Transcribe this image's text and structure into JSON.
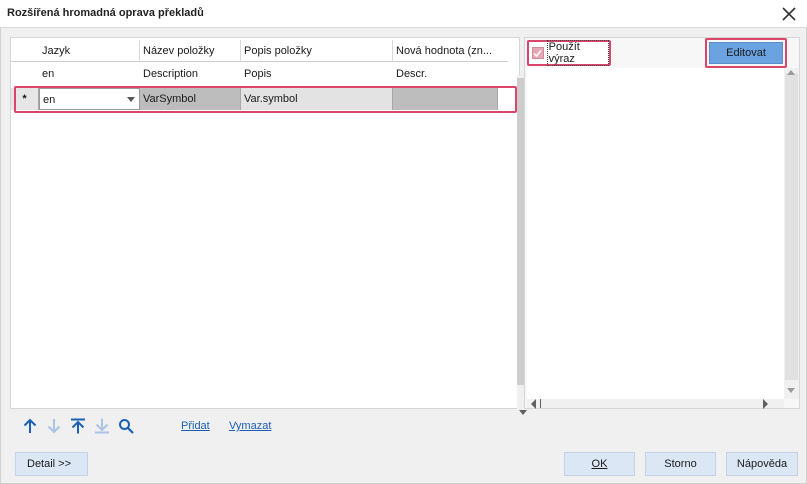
{
  "window": {
    "title": "Rozšířená hromadná oprava překladů"
  },
  "grid": {
    "columns": [
      "Jazyk",
      "Název položky",
      "Popis položky",
      "Nová hodnota (zn..."
    ],
    "rows": [
      {
        "indicator": "",
        "jazyk": "en",
        "nazev": "Description",
        "popis": "Popis",
        "nova": "Descr."
      },
      {
        "indicator": "*",
        "jazyk": "en",
        "nazev": "VarSymbol",
        "popis": "Var.symbol",
        "nova": ""
      }
    ]
  },
  "expression": {
    "checkbox_label": "Použít výraz",
    "checked": true,
    "edit_button": "Editovat"
  },
  "toolbar": {
    "icons": [
      "arrow-up-icon",
      "arrow-down-icon",
      "move-to-top-icon",
      "move-to-bottom-icon",
      "search-icon"
    ],
    "add_link": "Přidat",
    "delete_link": "Vymazat"
  },
  "buttons": {
    "detail": "Detail >>",
    "ok": "OK",
    "storno": "Storno",
    "napoveda": "Nápověda"
  },
  "colors": {
    "highlight": "#d9456b",
    "accent_button": "#6aa3e0",
    "selected_row": "#bdbdbd",
    "icon_blue": "#1a5fb4"
  }
}
